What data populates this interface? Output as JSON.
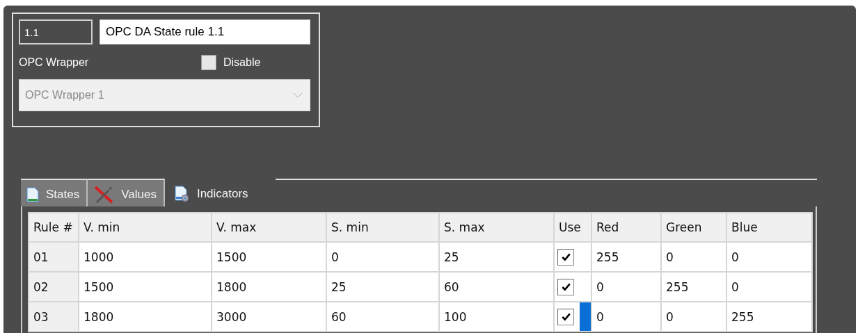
{
  "rule": {
    "id": "1.1",
    "name": "OPC DA State rule 1.1",
    "wrapper_label": "OPC Wrapper",
    "disable": {
      "label": "Disable",
      "checked": false
    },
    "wrapper": {
      "value": "OPC Wrapper 1",
      "disabled": true
    }
  },
  "tabs": [
    {
      "label": "States",
      "kind": "document",
      "selected": false
    },
    {
      "label": "Values",
      "kind": "tools",
      "selected": false
    },
    {
      "label": "Indicators",
      "kind": "settings-document",
      "selected": true
    }
  ],
  "table": {
    "columns": [
      "Rule #",
      "V. min",
      "V. max",
      "S. min",
      "S. max",
      "Use",
      "Red",
      "Green",
      "Blue"
    ],
    "rows": [
      {
        "rule": "01",
        "v_min": "1000",
        "v_max": "1500",
        "s_min": "0",
        "s_max": "25",
        "use": {
          "checked": true,
          "focused": false
        },
        "red": "255",
        "green": "0",
        "blue": "0"
      },
      {
        "rule": "02",
        "v_min": "1500",
        "v_max": "1800",
        "s_min": "25",
        "s_max": "60",
        "use": {
          "checked": true,
          "focused": false
        },
        "red": "0",
        "green": "255",
        "blue": "0"
      },
      {
        "rule": "03",
        "v_min": "1800",
        "v_max": "3000",
        "s_min": "60",
        "s_max": "100",
        "use": {
          "checked": true,
          "focused": true
        },
        "red": "0",
        "green": "0",
        "blue": "255"
      }
    ]
  }
}
